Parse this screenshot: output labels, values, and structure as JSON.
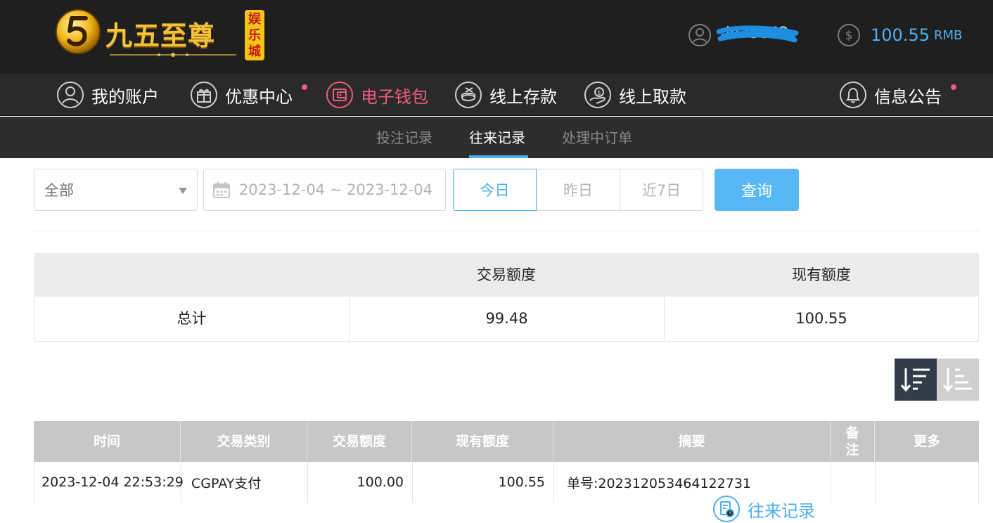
{
  "header": {
    "brand_name": "九五至尊",
    "brand_tag": "娱乐城",
    "username": "lo75842",
    "balance_amount": "100.55",
    "balance_currency": "RMB"
  },
  "nav": {
    "items": [
      {
        "label": "我的账户",
        "icon": "user-circle-icon"
      },
      {
        "label": "优惠中心",
        "icon": "gift-icon",
        "dot": true
      },
      {
        "label": "电子钱包",
        "icon": "wallet-icon",
        "active": true
      },
      {
        "label": "线上存款",
        "icon": "deposit-icon"
      },
      {
        "label": "线上取款",
        "icon": "withdraw-icon"
      },
      {
        "label": "往来记录",
        "icon": "records-icon",
        "current": true
      },
      {
        "label": "信息公告",
        "icon": "bell-icon",
        "dot": true
      }
    ]
  },
  "subnav": {
    "tabs": [
      {
        "label": "投注记录"
      },
      {
        "label": "往来记录",
        "active": true
      },
      {
        "label": "处理中订单"
      }
    ]
  },
  "filters": {
    "type_select": "全部",
    "date_range": "2023-12-04 ~ 2023-12-04",
    "quick": [
      "今日",
      "昨日",
      "近7日"
    ],
    "quick_active": "今日",
    "search_label": "查询"
  },
  "summary": {
    "headers": [
      "",
      "交易额度",
      "现有额度"
    ],
    "row": [
      "总计",
      "99.48",
      "100.55"
    ]
  },
  "records": {
    "headers": [
      "时间",
      "交易类别",
      "交易额度",
      "现有额度",
      "摘要",
      "备注",
      "更多"
    ],
    "rows": [
      [
        "2023-12-04 22:53:29",
        "CGPAY支付",
        "100.00",
        "100.55",
        "单号:2023120534641227​31",
        "",
        ""
      ]
    ]
  },
  "colors": {
    "accent_blue": "#4fb0f0",
    "accent_pink": "#f05c80",
    "header_bg": "#1f1f1f",
    "button_blue": "#58b8f5"
  }
}
